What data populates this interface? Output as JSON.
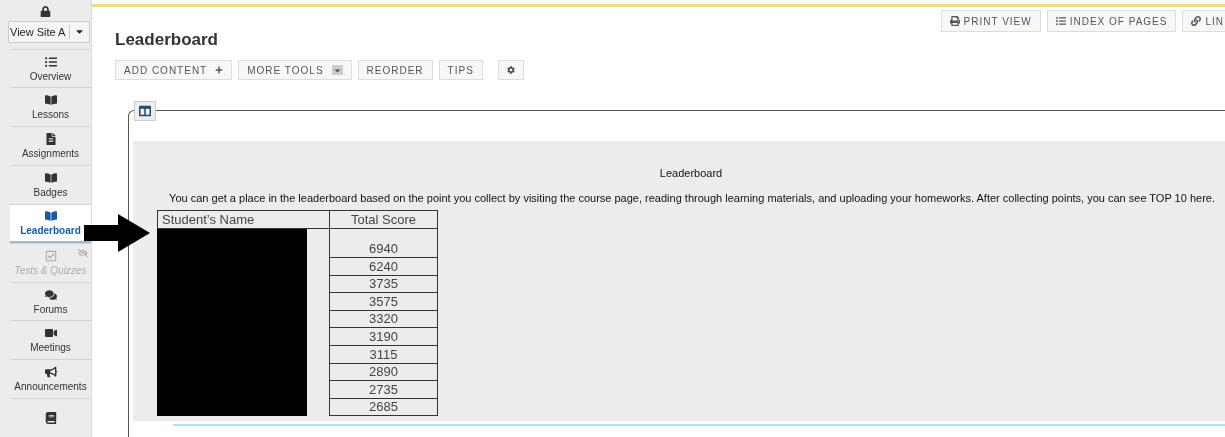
{
  "sidebar": {
    "view_site_as": {
      "value": "View Site A"
    },
    "items": [
      {
        "kind": "list",
        "label": "Overview",
        "selected": false,
        "disabled": false
      },
      {
        "kind": "book",
        "label": "Lessons",
        "selected": false,
        "disabled": false
      },
      {
        "kind": "file",
        "label": "Assignments",
        "selected": false,
        "disabled": false
      },
      {
        "kind": "book",
        "label": "Badges",
        "selected": false,
        "disabled": false
      },
      {
        "kind": "book",
        "label": "Leaderboard",
        "selected": true,
        "disabled": false
      },
      {
        "kind": "check",
        "label": "Tests & Quizzes",
        "selected": false,
        "disabled": true
      },
      {
        "kind": "comments",
        "label": "Forums",
        "selected": false,
        "disabled": false
      },
      {
        "kind": "video",
        "label": "Meetings",
        "selected": false,
        "disabled": false
      },
      {
        "kind": "bullhorn",
        "label": "Announcements",
        "selected": false,
        "disabled": false
      },
      {
        "kind": "gradebook",
        "selected": false,
        "disabled": false
      }
    ]
  },
  "top_buttons": [
    {
      "kind": "print",
      "label": "PRINT VIEW"
    },
    {
      "kind": "index",
      "label": "INDEX OF PAGES"
    },
    {
      "kind": "link",
      "label": "LIN"
    }
  ],
  "page_title": "Leaderboard",
  "toolbar": [
    {
      "kind": "plus",
      "label": "ADD CONTENT"
    },
    {
      "kind": "dropdown",
      "label": "MORE TOOLS"
    },
    {
      "kind": "plain",
      "label": "REORDER"
    },
    {
      "kind": "plain",
      "label": "TIPS"
    },
    {
      "kind": "gear"
    }
  ],
  "content": {
    "heading": "Leaderboard",
    "description": "You can get a place in the leaderboard based on the point you collect by visiting the course page, reading through learning materials,  and uploading your homeworks. After collecting points, you can see TOP 10 here.",
    "table": {
      "columns": [
        "Student’s Name",
        "Total Score"
      ],
      "rows": [
        {
          "score": "6940"
        },
        {
          "score": "6240"
        },
        {
          "score": "3735"
        },
        {
          "score": "3575"
        },
        {
          "score": "3320"
        },
        {
          "score": "3190"
        },
        {
          "score": "3115"
        },
        {
          "score": "2890"
        },
        {
          "score": "2735"
        },
        {
          "score": "2685"
        }
      ]
    }
  }
}
